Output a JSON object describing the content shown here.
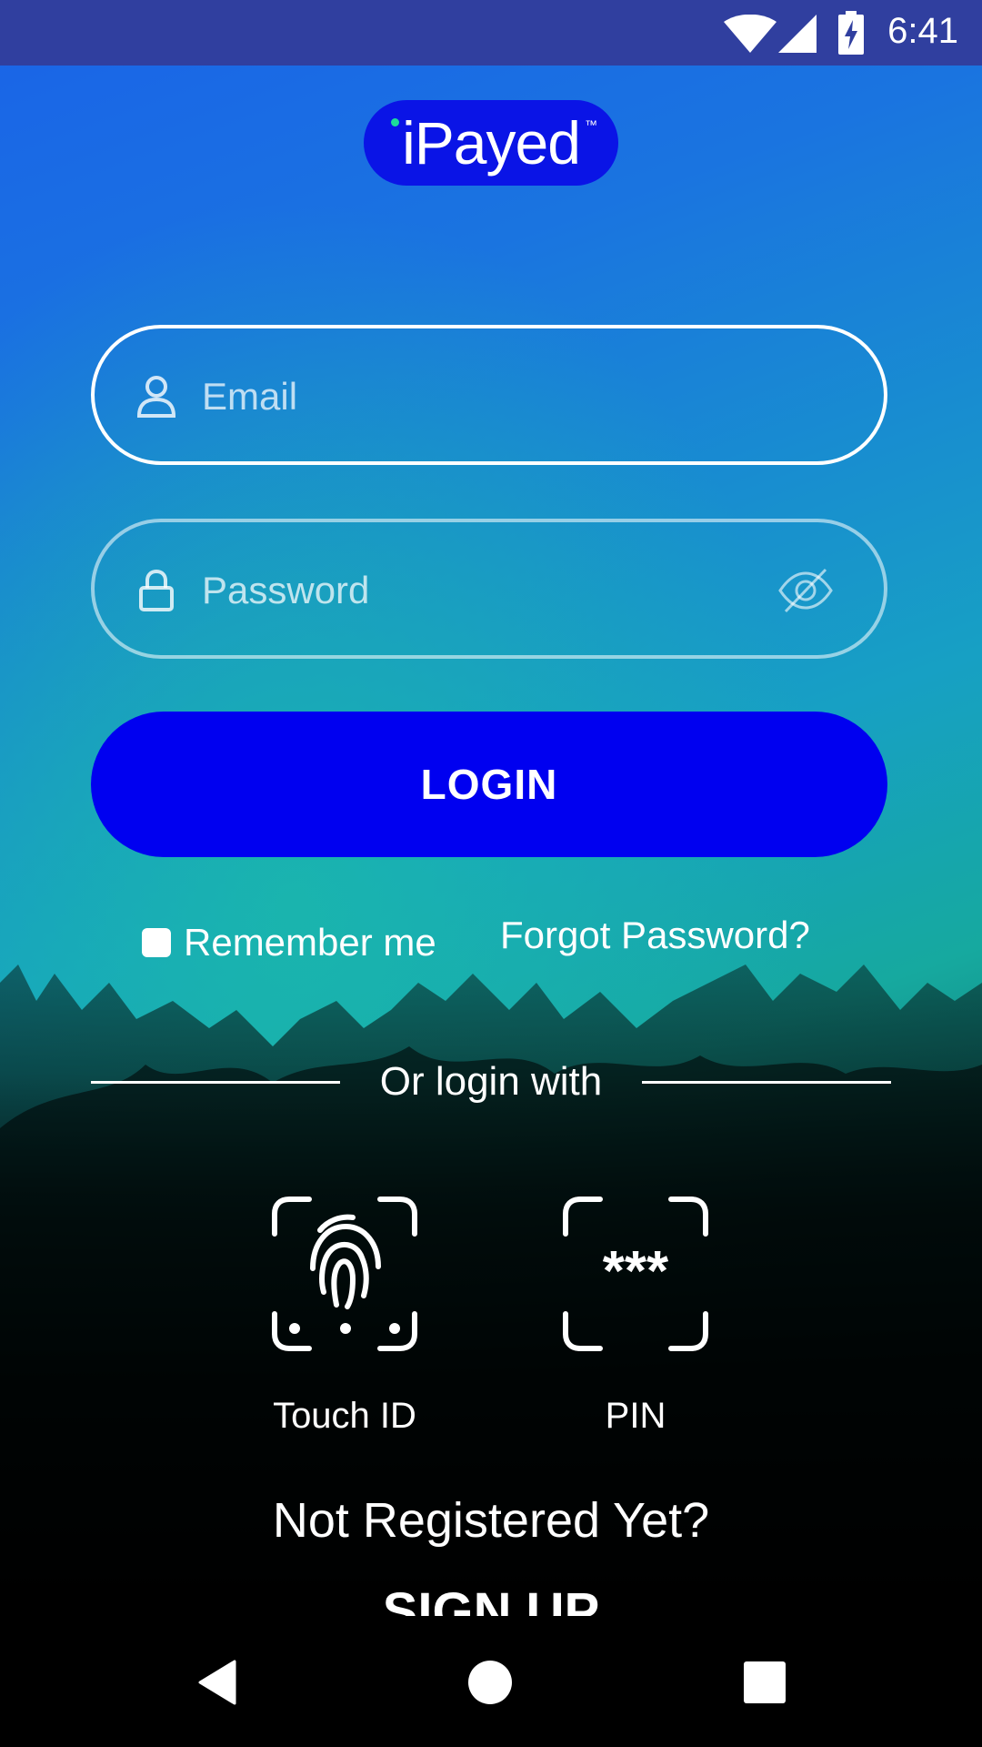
{
  "status_bar": {
    "time": "6:41"
  },
  "logo": {
    "text": "iPayed",
    "trademark": "™"
  },
  "email": {
    "placeholder": "Email"
  },
  "password": {
    "placeholder": "Password"
  },
  "login_button": "LOGIN",
  "remember": {
    "label": "Remember me",
    "checked": false
  },
  "forgot": "Forgot Password?",
  "or_login_with": "Or login with",
  "alternatives": [
    {
      "label": "Touch ID",
      "icon": "fingerprint-icon"
    },
    {
      "label": "PIN",
      "icon": "pin-icon"
    }
  ],
  "not_registered": "Not Registered Yet?",
  "signup": "SIGN UP",
  "colors": {
    "status_bar": "#303f9f",
    "login_button": "#0000f0",
    "logo_background": "#0a14e6"
  }
}
